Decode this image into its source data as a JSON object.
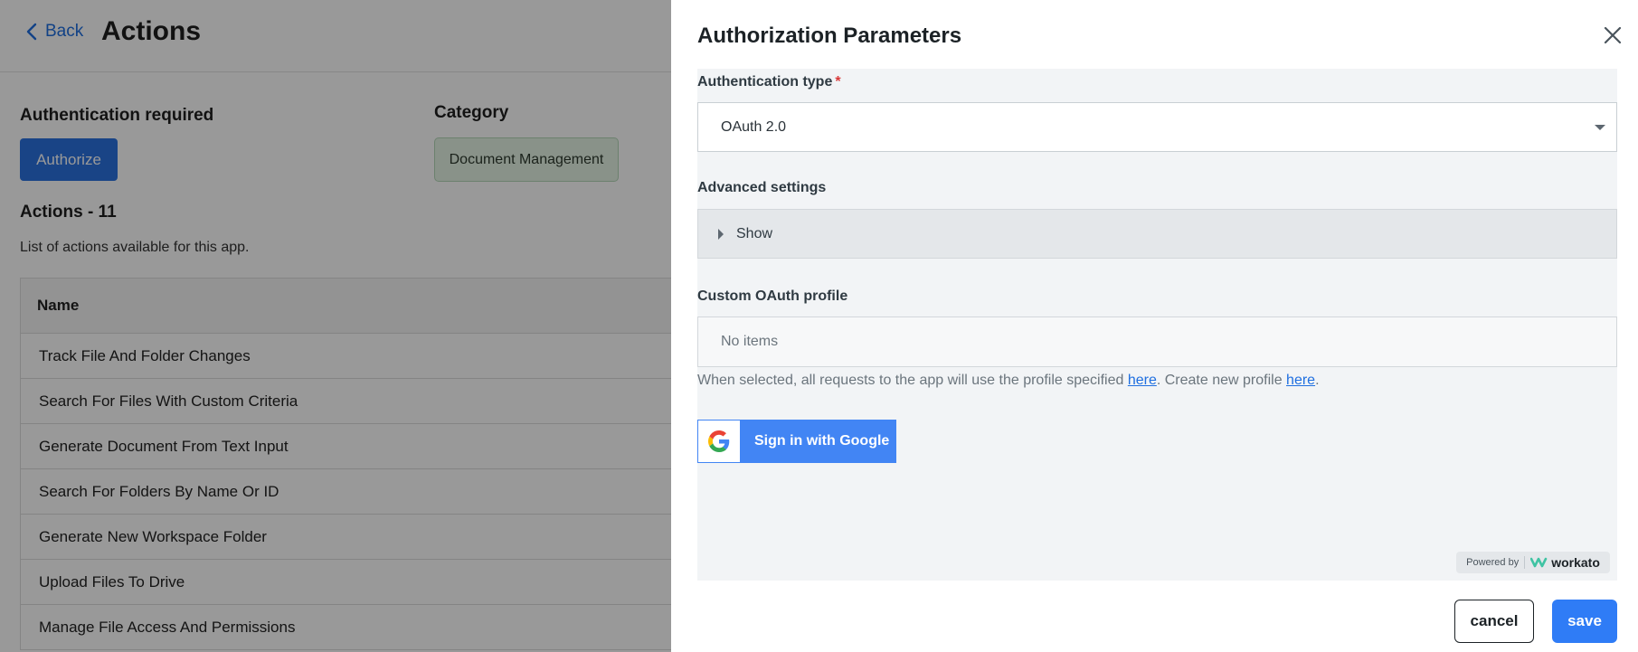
{
  "background": {
    "back_label": "Back",
    "title": "Actions",
    "auth_required_label": "Authentication required",
    "authorize_label": "Authorize",
    "category_label": "Category",
    "category_value": "Document Management",
    "actions_count_label": "Actions - 11",
    "actions_description": "List of actions available for this app.",
    "table": {
      "header": "Name",
      "rows": [
        "Track File And Folder Changes",
        "Search For Files With Custom Criteria",
        "Generate Document From Text Input",
        "Search For Folders By Name Or ID",
        "Generate New Workspace Folder",
        "Upload Files To Drive",
        "Manage File Access And Permissions"
      ]
    }
  },
  "drawer": {
    "title": "Authorization Parameters",
    "auth_type": {
      "label": "Authentication type",
      "required_mark": "*",
      "value": "OAuth 2.0"
    },
    "advanced": {
      "label": "Advanced settings",
      "show_label": "Show"
    },
    "oauth_profile": {
      "label": "Custom OAuth profile",
      "placeholder": "No items",
      "hint_prefix": "When selected, all requests to the app will use the profile specified ",
      "hint_link1": "here",
      "hint_middle": ". Create new profile ",
      "hint_link2": "here",
      "hint_suffix": "."
    },
    "google_button_label": "Sign in with Google",
    "powered_by": "Powered by",
    "brand": "workato",
    "cancel_label": "cancel",
    "save_label": "save"
  },
  "colors": {
    "accent": "#2f7cf6",
    "link": "#1f6fe0",
    "google_blue": "#4285f4",
    "required": "#d93838",
    "overlay": "rgba(0,0,0,0.4)"
  },
  "icons": {
    "back": "chevron-left-icon",
    "close": "close-icon",
    "dropdown": "caret-down-icon",
    "expand": "caret-right-icon",
    "google": "google-g-icon",
    "brand": "workato-logo-icon"
  }
}
